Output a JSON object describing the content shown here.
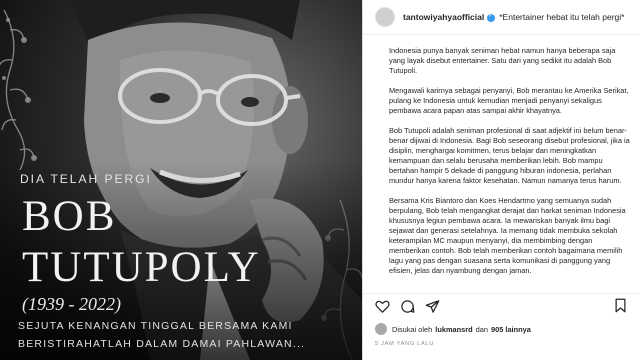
{
  "photo": {
    "heading": "DIA TELAH PERGI",
    "name_line1": "BOB",
    "name_line2": "TUTUPOLY",
    "years": "(1939 - 2022)",
    "memorial_line1": "SEJUTA KENANGAN TINGGAL BERSAMA KAMI",
    "memorial_line2": "BERISTIRAHATLAH DALAM DAMAI PAHLAWAN..."
  },
  "post": {
    "username": "tantowiyahyaofficial",
    "header_caption": "*Entertainer hebat itu telah pergi*",
    "paragraphs": [
      "Indonesia punya banyak seniman hebat namun hanya beberapa saja yang layak disebut entertainer. Satu dari yang sedikit itu adalah Bob Tutupoli.",
      "Mengawali karirnya sebagai penyanyi, Bob merantau ke Amerika Serikat, pulang ke Indonesia untuk kemudian menjadi penyanyi sekaligus pembawa acara papan atas sampai akhir khayatnya.",
      "Bob Tutupoli adalah seniman profesional di saat adjektif ini belum benar-benar dijiwai di Indonesia. Bagi Bob seseorang disebut profesional, jika ia disiplin, menghargai komitmen, terus belajar dan meningkatkan kemampuan dan selalu berusaha memberikan lebih. Bob mampu bertahan hampir 5 dekade di panggung hiburan indonesia, perlahan mundur hanya karena faktor kesehatan. Namun namanya terus harum.",
      "Bersama Kris Biantoro dan Koes Hendartmo yang semuanya sudah berpulang, Bob telah mengangkat derajat dan harkat seniman Indonesia khususnya legiun pembawa acara. Ia mewariskan banyak ilmu bagi sejawat dan generasi setelahnya. Ia memang tidak membuka sekolah keterampilan MC maupun menyanyi, dia membimbing dengan memberikan contoh. Bob telah memberikan contoh bagaimana memilih lagu yang pas dengan suasana serta komunikasi di panggung yang efisien, jelas dan nyambung dengan jaman."
    ],
    "likes_prefix": "Disukai oleh",
    "likes_user": "lukmansrd",
    "likes_and": "dan",
    "likes_count": "905 lainnya",
    "timestamp": "5 JAM YANG LALU"
  },
  "icons": {
    "like": "heart-icon",
    "comment": "comment-icon",
    "share": "share-icon",
    "save": "bookmark-icon",
    "verified": "verified-badge-icon"
  }
}
